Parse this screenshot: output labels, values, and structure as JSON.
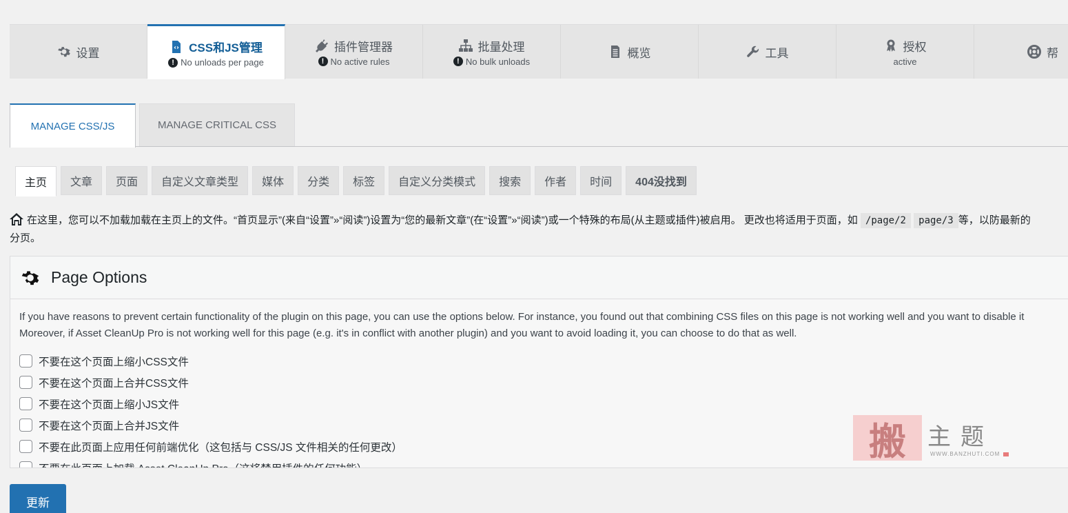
{
  "top_tabs": [
    {
      "label": "设置",
      "sub": "",
      "icon": "gear-icon",
      "active": false
    },
    {
      "label": "CSS和JS管理",
      "sub": "No unloads per page",
      "icon": "code-file-icon",
      "active": true
    },
    {
      "label": "插件管理器",
      "sub": "No active rules",
      "icon": "plug-icon",
      "active": false
    },
    {
      "label": "批量处理",
      "sub": "No bulk unloads",
      "icon": "sitemap-icon",
      "active": false
    },
    {
      "label": "概览",
      "sub": "",
      "icon": "document-icon",
      "active": false
    },
    {
      "label": "工具",
      "sub": "",
      "icon": "wrench-icon",
      "active": false
    },
    {
      "label": "授权",
      "sub": "active",
      "icon": "award-icon",
      "active": false
    },
    {
      "label": "帮",
      "sub": "",
      "icon": "lifebuoy-icon",
      "active": false
    }
  ],
  "sub_tabs": {
    "manage_css_js": "MANAGE CSS/JS",
    "manage_critical_css": "MANAGE CRITICAL CSS"
  },
  "type_tabs": [
    "主页",
    "文章",
    "页面",
    "自定义文章类型",
    "媒体",
    "分类",
    "标签",
    "自定义分类模式",
    "搜索",
    "作者",
    "时间",
    "404没找到"
  ],
  "description": {
    "part1": "在这里，您可以不加载加载在主页上的文件。“首页显示”(来自“设置”»“阅读”)设置为“您的最新文章”(在“设置”»“阅读”)或一个特殊的布局(从主题或插件)被启用。 更改也将适用于页面，如",
    "code1": "/page/2",
    "code2": "page/3",
    "part2": "等，以防最新的",
    "line2": "分页。"
  },
  "panel": {
    "title": "Page Options",
    "text_line1": "If you have reasons to prevent certain functionality of the plugin on this page, you can use the options below. For instance, you found out that combining CSS files on this page is not working well and you want to disable it",
    "text_line2": "Moreover, if Asset CleanUp Pro is not working well for this page (e.g. it's in conflict with another plugin) and you want to avoid loading it, you can choose to do that as well.",
    "options": [
      "不要在这个页面上缩小CSS文件",
      "不要在这个页面上合并CSS文件",
      "不要在这个页面上缩小JS文件",
      "不要在这个页面上合并JS文件",
      "不要在此页面上应用任何前端优化（这包括与 CSS/JS 文件相关的任何更改）",
      "不要在此页面上加载 Asset CleanUp Pro（这将禁用插件的任何功能）"
    ]
  },
  "update_button": "更新",
  "watermark": {
    "char": "搬",
    "title": "主题",
    "url": "WWW.BANZHUTI.COM"
  },
  "colors": {
    "accent": "#2271b1",
    "background": "#f1f1f1"
  }
}
